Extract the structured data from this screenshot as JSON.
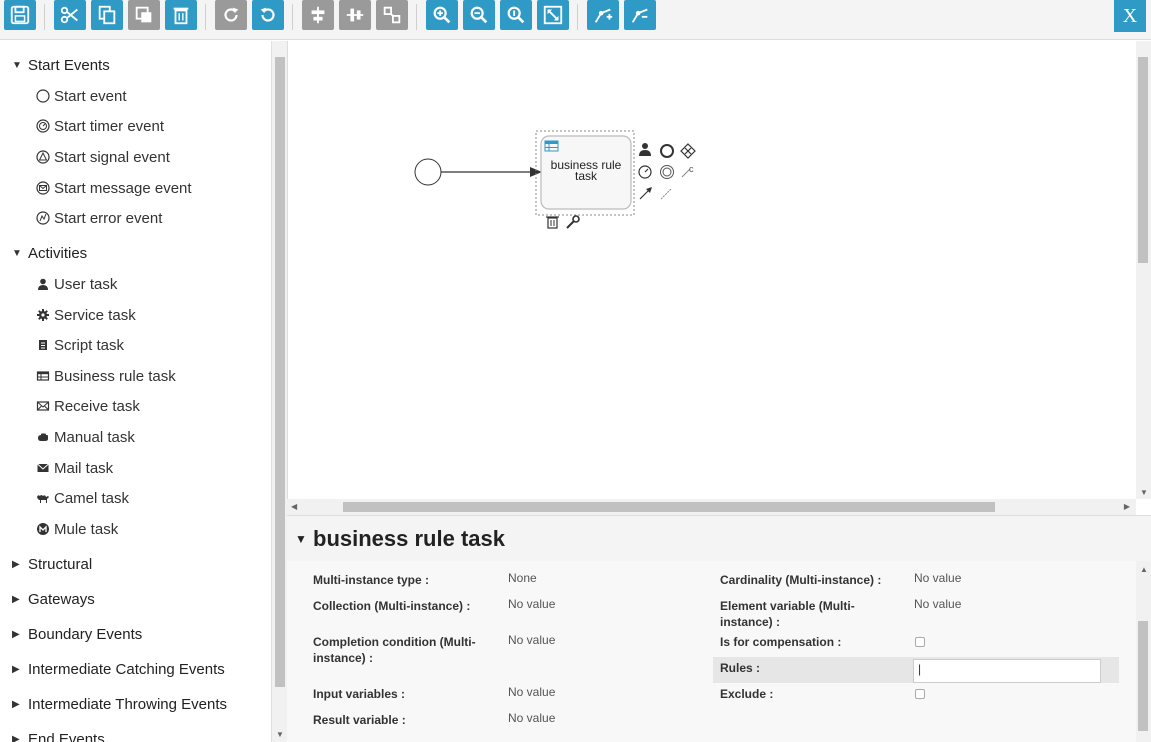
{
  "toolbar": {
    "close_label": "X"
  },
  "palette": {
    "groups": [
      {
        "label": "Start Events",
        "expanded": true
      },
      {
        "label": "Activities",
        "expanded": true
      },
      {
        "label": "Structural",
        "expanded": false
      },
      {
        "label": "Gateways",
        "expanded": false
      },
      {
        "label": "Boundary Events",
        "expanded": false
      },
      {
        "label": "Intermediate Catching Events",
        "expanded": false
      },
      {
        "label": "Intermediate Throwing Events",
        "expanded": false
      },
      {
        "label": "End Events",
        "expanded": false
      }
    ],
    "start_items": [
      {
        "label": "Start event",
        "icon": "circle-icon"
      },
      {
        "label": "Start timer event",
        "icon": "timer-icon"
      },
      {
        "label": "Start signal event",
        "icon": "signal-icon"
      },
      {
        "label": "Start message event",
        "icon": "message-icon"
      },
      {
        "label": "Start error event",
        "icon": "error-icon"
      }
    ],
    "activity_items": [
      {
        "label": "User task",
        "icon": "user-icon"
      },
      {
        "label": "Service task",
        "icon": "gear-icon"
      },
      {
        "label": "Script task",
        "icon": "script-icon"
      },
      {
        "label": "Business rule task",
        "icon": "table-icon"
      },
      {
        "label": "Receive task",
        "icon": "envelope-icon"
      },
      {
        "label": "Manual task",
        "icon": "hand-icon"
      },
      {
        "label": "Mail task",
        "icon": "mail-icon"
      },
      {
        "label": "Camel task",
        "icon": "camel-icon"
      },
      {
        "label": "Mule task",
        "icon": "mule-icon"
      }
    ]
  },
  "canvas": {
    "task_label": "business rule task"
  },
  "properties": {
    "title": "business rule task",
    "fields": {
      "multi_instance_type_label": "Multi-instance type :",
      "multi_instance_type_value": "None",
      "cardinality_label": "Cardinality (Multi-instance) :",
      "cardinality_value": "No value",
      "collection_label": "Collection (Multi-instance) :",
      "collection_value": "No value",
      "element_variable_label": "Element variable (Multi-instance) :",
      "element_variable_value": "No value",
      "completion_label": "Completion condition (Multi-instance) :",
      "completion_value": "No value",
      "is_for_compensation_label": "Is for compensation :",
      "rules_label": "Rules :",
      "rules_value": "|",
      "input_variables_label": "Input variables :",
      "input_variables_value": "No value",
      "exclude_label": "Exclude :",
      "result_variable_label": "Result variable :",
      "result_variable_value": "No value"
    }
  },
  "colors": {
    "accent": "#2f9ac6",
    "disabled": "#9a9a9a"
  }
}
